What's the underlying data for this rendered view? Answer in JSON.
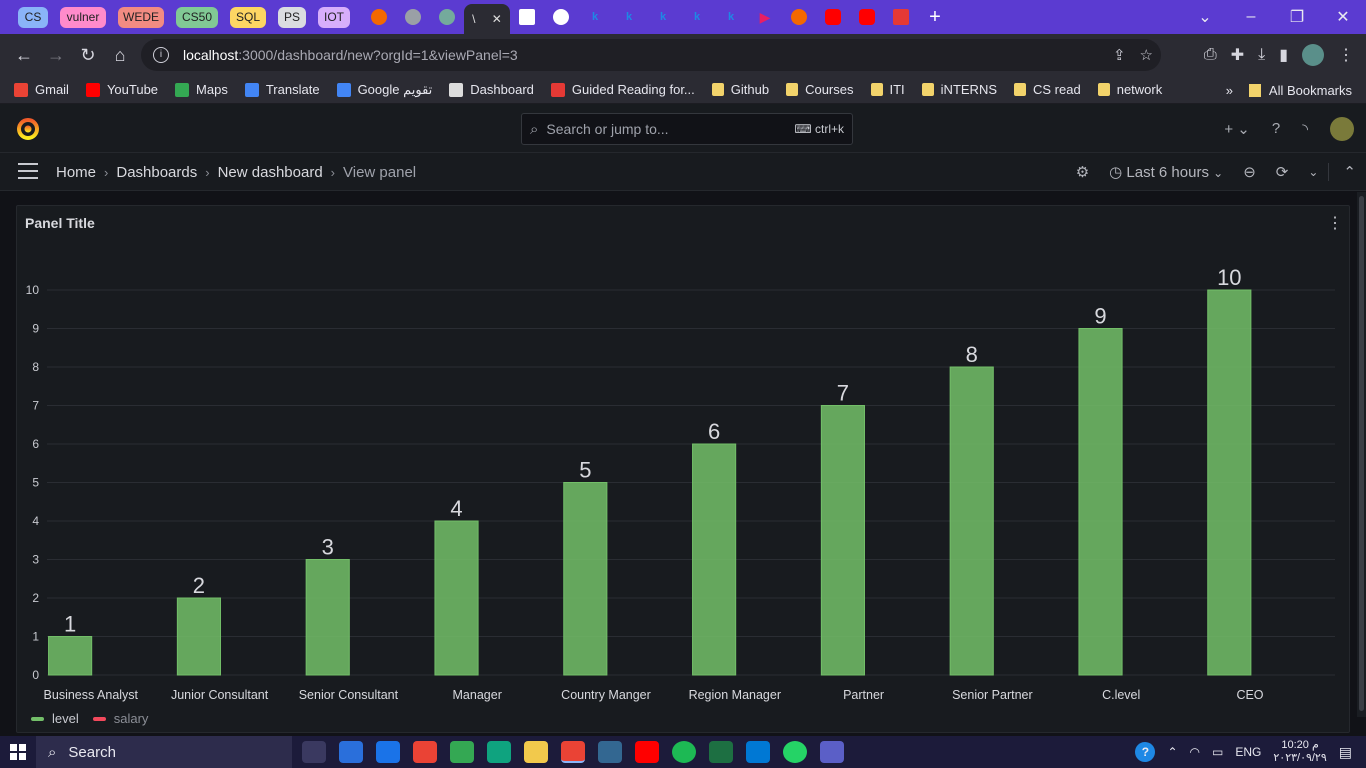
{
  "browser": {
    "tab_groups": [
      {
        "label": "CS",
        "color": "#8ab4f8"
      },
      {
        "label": "vulner",
        "color": "#ff8bcb"
      },
      {
        "label": "WEDE",
        "color": "#f28b82"
      },
      {
        "label": "CS50",
        "color": "#81c995"
      },
      {
        "label": "SQL",
        "color": "#fdd663"
      },
      {
        "label": "PS",
        "color": "#dadce0"
      },
      {
        "label": "IOT",
        "color": "#d7aefb"
      }
    ],
    "active_tab_label": "\\",
    "address": {
      "host": "localhost",
      "path": ":3000/dashboard/new?orgId=1&viewPanel=3"
    },
    "bookmarks": [
      {
        "label": "Gmail",
        "icon": "gmail-icon",
        "color": "#ea4335"
      },
      {
        "label": "YouTube",
        "icon": "youtube-icon",
        "color": "#ff0000"
      },
      {
        "label": "Maps",
        "icon": "maps-icon",
        "color": "#34a853"
      },
      {
        "label": "Translate",
        "icon": "translate-icon",
        "color": "#4285f4"
      },
      {
        "label": "Google تقويم",
        "icon": "calendar-icon",
        "color": "#4285f4"
      },
      {
        "label": "Dashboard",
        "icon": "page-icon",
        "color": "#dddddd"
      },
      {
        "label": "Guided Reading for...",
        "icon": "s-icon",
        "color": "#e53935"
      },
      {
        "label": "Github",
        "icon": "folder-icon",
        "color": "#f2d36b"
      },
      {
        "label": "Courses",
        "icon": "folder-icon",
        "color": "#f2d36b"
      },
      {
        "label": "ITI",
        "icon": "folder-icon",
        "color": "#f2d36b"
      },
      {
        "label": "iNTERNS",
        "icon": "folder-icon",
        "color": "#f2d36b"
      },
      {
        "label": "CS read",
        "icon": "folder-icon",
        "color": "#f2d36b"
      },
      {
        "label": "network",
        "icon": "folder-icon",
        "color": "#f2d36b"
      }
    ],
    "bookmarks_overflow": "»",
    "all_bookmarks": "All Bookmarks"
  },
  "grafana": {
    "search_placeholder": "Search or jump to...",
    "search_shortcut": "ctrl+k",
    "breadcrumbs": [
      "Home",
      "Dashboards",
      "New dashboard",
      "View panel"
    ],
    "time_range": "Last 6 hours",
    "panel_title": "Panel Title",
    "legend": [
      {
        "name": "level",
        "color": "#73bf69"
      },
      {
        "name": "salary",
        "color": "#f2495c"
      }
    ]
  },
  "chart_data": {
    "type": "bar",
    "categories": [
      "Business Analyst",
      "Junior Consultant",
      "Senior Consultant",
      "Manager",
      "Country Manger",
      "Region Manager",
      "Partner",
      "Senior Partner",
      "C.level",
      "CEO"
    ],
    "series": [
      {
        "name": "level",
        "values": [
          1,
          2,
          3,
          4,
          5,
          6,
          7,
          8,
          9,
          10
        ],
        "color": "#73bf69"
      }
    ],
    "ylim": [
      0,
      10
    ],
    "yticks": [
      0,
      1,
      2,
      3,
      4,
      5,
      6,
      7,
      8,
      9,
      10
    ],
    "show_values": true,
    "grid": true,
    "legend_position": "bottom-left"
  },
  "taskbar": {
    "search_label": "Search",
    "language": "ENG",
    "time": "10:20 م",
    "date": "٢٠٢٣/٠٩/٢٩"
  }
}
